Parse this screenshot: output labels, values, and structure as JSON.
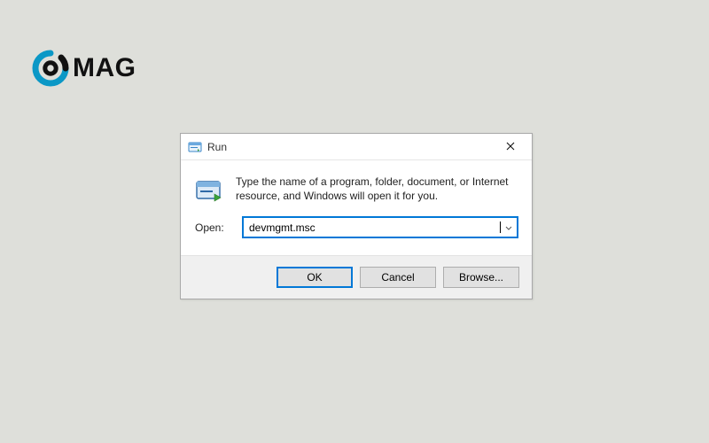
{
  "logo": {
    "text": "MAG"
  },
  "dialog": {
    "title": "Run",
    "instruction": "Type the name of a program, folder, document, or Internet resource, and Windows will open it for you.",
    "open_label": "Open:",
    "open_value": "devmgmt.msc",
    "buttons": {
      "ok": "OK",
      "cancel": "Cancel",
      "browse": "Browse..."
    }
  }
}
